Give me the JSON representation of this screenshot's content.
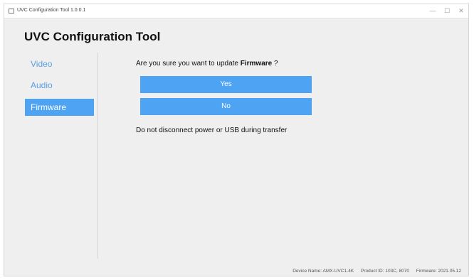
{
  "window": {
    "title": "UVC Configuration Tool 1.0.0.1",
    "minimize_glyph": "—",
    "maximize_glyph": "☐",
    "close_glyph": "✕"
  },
  "header": {
    "title": "UVC Configuration Tool"
  },
  "sidebar": {
    "items": [
      {
        "label": "Video",
        "active": false
      },
      {
        "label": "Audio",
        "active": false
      },
      {
        "label": "Firmware",
        "active": true
      }
    ]
  },
  "main": {
    "prompt_text": "Are you sure you want to update",
    "prompt_bold": "Firmware",
    "prompt_suffix": " ?",
    "yes_label": "Yes",
    "no_label": "No",
    "warning": "Do not disconnect power or USB during transfer"
  },
  "status": {
    "device_name": "Device Name: AMX-UVC1-4K",
    "product_id": "Product ID: 103C, 8070",
    "firmware": "Firmware: 2021.05.12"
  },
  "colors": {
    "accent": "#4ea3f2",
    "nav_text": "#5a9fe3",
    "window_bg": "#f0eff0"
  }
}
